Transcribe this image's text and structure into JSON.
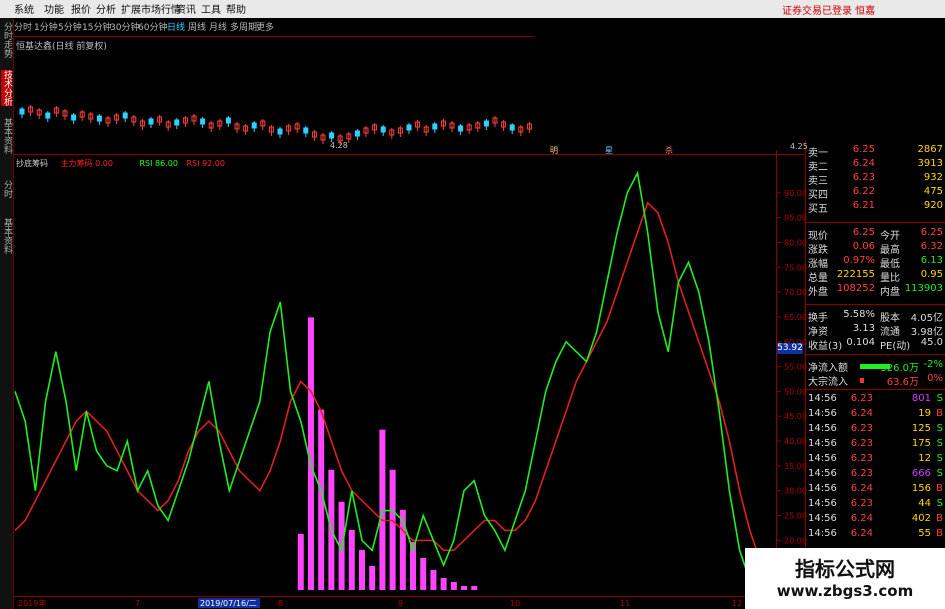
{
  "menu": [
    "系统",
    "功能",
    "报价",
    "分析",
    "扩展市场行情",
    "资讯",
    "工具",
    "帮助"
  ],
  "login_status": "证券交易已登录 恒嘉",
  "periods": [
    "分时",
    "1分钟",
    "5分钟",
    "15分钟",
    "30分钟",
    "60分钟",
    "日线",
    "周线",
    "月线",
    "多周期",
    "更多"
  ],
  "active_period": "日线",
  "left_tabs": [
    "分时走势",
    "技术分析",
    "基本资料"
  ],
  "left_tabs_lower": [
    "分时",
    "基本资料"
  ],
  "upper_panel": {
    "title": "恒基达鑫(日线 前复权)",
    "low_price_label": "4.28",
    "markers": [
      "明",
      "星",
      "杀"
    ],
    "corner_price": "4.25"
  },
  "indicator": {
    "name": "抄底筹码",
    "items": [
      {
        "label": "主力筹码",
        "value": "0.00",
        "color": "#ff2020"
      },
      {
        "label": "RSI",
        "value": "86.00",
        "color": "#20ff20"
      },
      {
        "label": "RSI",
        "value": "92.00",
        "color": "#ff2020"
      }
    ]
  },
  "right_axis": [
    "90.00",
    "85.00",
    "80.00",
    "75.00",
    "70.00",
    "65.00",
    "60.00",
    "55.00",
    "50.00",
    "45.00",
    "40.00",
    "35.00",
    "30.00",
    "25.00",
    "20.00",
    "15.00"
  ],
  "current_value_tag": "53.92",
  "bottom_axis": [
    "2019年",
    "7",
    "2019/07/16/二",
    "8",
    "9",
    "10",
    "11",
    "12"
  ],
  "quotes": {
    "orders": [
      {
        "label": "卖一",
        "price": "6.25",
        "vol": "2867"
      },
      {
        "label": "卖二",
        "price": "6.24",
        "vol": "3913"
      },
      {
        "label": "卖三",
        "price": "6.23",
        "vol": "932"
      },
      {
        "label": "买四",
        "price": "6.22",
        "vol": "475"
      },
      {
        "label": "买五",
        "price": "6.21",
        "vol": "920"
      }
    ],
    "stats": [
      {
        "l1": "现价",
        "v1": "6.25",
        "l2": "今开",
        "v2": "6.25"
      },
      {
        "l1": "涨跌",
        "v1": "0.06",
        "l2": "最高",
        "v2": "6.32"
      },
      {
        "l1": "涨幅",
        "v1": "0.97%",
        "l2": "最低",
        "v2": "6.13"
      },
      {
        "l1": "总量",
        "v1": "222155",
        "l2": "量比",
        "v2": "0.95"
      },
      {
        "l1": "外盘",
        "v1": "108252",
        "l2": "内盘",
        "v2": "113903"
      }
    ],
    "stats2": [
      {
        "l1": "换手",
        "v1": "5.58%",
        "l2": "股本",
        "v2": "4.05亿"
      },
      {
        "l1": "净资",
        "v1": "3.13",
        "l2": "流通",
        "v2": "3.98亿"
      },
      {
        "l1": "收益(3)",
        "v1": "0.104",
        "l2": "PE(动)",
        "v2": "45.0"
      }
    ],
    "flows": [
      {
        "label": "净流入额",
        "value": "-326.0万",
        "pct": "-2%"
      },
      {
        "label": "大宗流入",
        "value": "63.6万",
        "pct": "0%"
      }
    ],
    "ticks": [
      {
        "t": "14:56",
        "p": "6.23",
        "v": "801",
        "s": "S"
      },
      {
        "t": "14:56",
        "p": "6.24",
        "v": "19",
        "s": "B"
      },
      {
        "t": "14:56",
        "p": "6.23",
        "v": "125",
        "s": "S"
      },
      {
        "t": "14:56",
        "p": "6.23",
        "v": "175",
        "s": "S"
      },
      {
        "t": "14:56",
        "p": "6.23",
        "v": "12",
        "s": "S"
      },
      {
        "t": "14:56",
        "p": "6.23",
        "v": "666",
        "s": "S"
      },
      {
        "t": "14:56",
        "p": "6.24",
        "v": "156",
        "s": "B"
      },
      {
        "t": "14:56",
        "p": "6.23",
        "v": "44",
        "s": "S"
      },
      {
        "t": "14:56",
        "p": "6.24",
        "v": "402",
        "s": "B"
      },
      {
        "t": "14:56",
        "p": "6.24",
        "v": "55",
        "s": "B"
      }
    ]
  },
  "watermark": {
    "line1": "指标公式网",
    "line2": "www.zbgs3.com"
  },
  "chart_data": {
    "type": "line",
    "x_count": 74,
    "ylim": [
      10,
      95
    ],
    "series": [
      {
        "name": "RSI",
        "color": "#20ee20",
        "values": [
          50,
          44,
          30,
          48,
          58,
          48,
          34,
          46,
          38,
          35,
          34,
          40,
          30,
          34,
          27,
          24,
          30,
          36,
          44,
          52,
          40,
          30,
          36,
          42,
          48,
          62,
          68,
          50,
          44,
          35,
          30,
          22,
          18,
          30,
          20,
          18,
          26,
          26,
          24,
          18,
          25,
          20,
          15,
          20,
          30,
          32,
          25,
          22,
          18,
          24,
          30,
          40,
          50,
          56,
          60,
          58,
          56,
          62,
          72,
          82,
          90,
          94,
          82,
          66,
          58,
          72,
          76,
          70,
          60,
          46,
          30,
          18,
          12,
          10
        ]
      },
      {
        "name": "RSI",
        "color": "#e02020",
        "values": [
          22,
          24,
          28,
          32,
          36,
          40,
          44,
          46,
          44,
          42,
          38,
          34,
          30,
          28,
          26,
          28,
          32,
          38,
          42,
          44,
          42,
          38,
          34,
          32,
          30,
          34,
          40,
          48,
          52,
          50,
          46,
          40,
          34,
          30,
          28,
          26,
          24,
          24,
          22,
          20,
          20,
          20,
          18,
          18,
          20,
          22,
          24,
          24,
          22,
          22,
          24,
          28,
          34,
          40,
          46,
          52,
          56,
          60,
          64,
          70,
          76,
          82,
          88,
          86,
          80,
          72,
          66,
          60,
          54,
          48,
          40,
          30,
          22,
          16
        ]
      },
      {
        "name": "主力筹码",
        "color": "#ff44ff",
        "values": [
          0,
          0,
          0,
          0,
          0,
          0,
          0,
          0,
          0,
          0,
          0,
          0,
          0,
          0,
          0,
          0,
          0,
          0,
          0,
          0,
          0,
          0,
          0,
          0,
          0,
          0,
          0,
          0,
          14,
          68,
          45,
          30,
          22,
          15,
          10,
          6,
          40,
          30,
          20,
          12,
          8,
          5,
          3,
          2,
          1,
          1,
          0,
          0,
          0,
          0,
          0,
          0,
          0,
          0,
          0,
          0,
          0,
          0,
          0,
          0,
          0,
          0,
          0,
          0,
          0,
          0,
          0,
          0,
          0,
          0,
          0,
          0,
          0,
          0
        ]
      }
    ],
    "xlabels": [
      "2019年",
      "7",
      "2019/07/16/二",
      "8",
      "9",
      "10",
      "11",
      "12"
    ]
  }
}
